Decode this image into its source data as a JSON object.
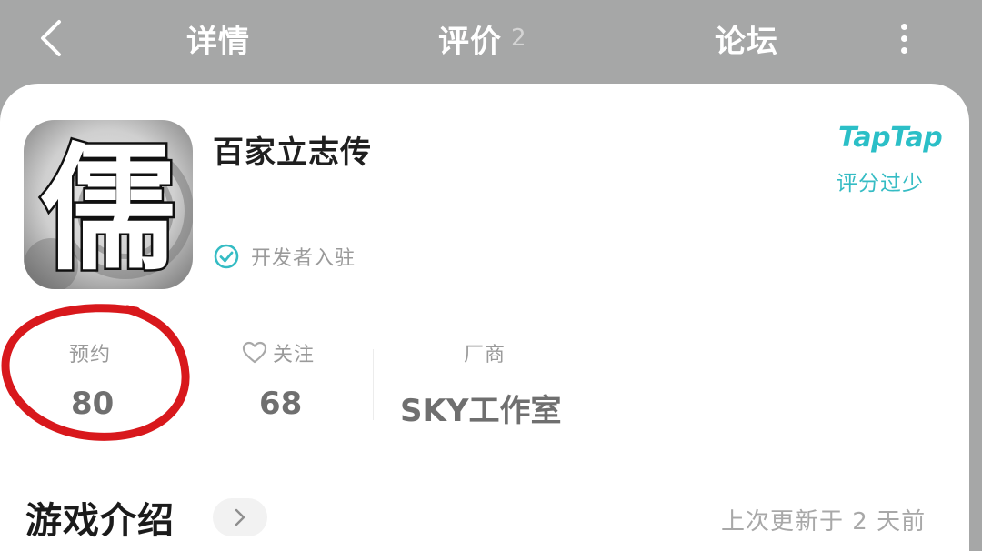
{
  "nav": {
    "tabs": [
      {
        "label": "详情"
      },
      {
        "label": "评价",
        "count": "2"
      },
      {
        "label": "论坛"
      }
    ]
  },
  "app": {
    "name": "百家立志传",
    "icon_glyph": "儒",
    "verified_label": "开发者入驻"
  },
  "rating": {
    "logo": "TapTap",
    "note": "评分过少"
  },
  "stats": {
    "reserve": {
      "label": "预约",
      "value": "80"
    },
    "follow": {
      "label": "关注",
      "value": "68"
    },
    "developer": {
      "label": "厂商",
      "value": "SKY工作室"
    }
  },
  "intro": {
    "title": "游戏介绍",
    "updated": "上次更新于 2 天前"
  },
  "colors": {
    "topbar": "#a6a7a7",
    "accent": "#2bbfc7",
    "highlight_circle": "#d8181c"
  },
  "icons": [
    "back-icon",
    "more-icon",
    "verified-check-icon",
    "heart-icon",
    "chevron-right-icon"
  ]
}
